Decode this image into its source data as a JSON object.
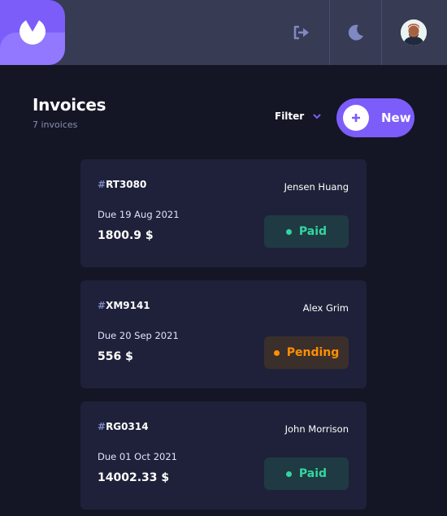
{
  "header": {
    "logo_icon": "logo-icon",
    "icons": [
      "logout-icon",
      "moon-icon"
    ],
    "avatar": "avatar"
  },
  "page": {
    "title": "Invoices",
    "count": "7 invoices"
  },
  "toolbar": {
    "filter_label": "Filter",
    "new_label": "New"
  },
  "colors": {
    "accent": "#7c5dfa",
    "background": "#141625",
    "card": "#1e2139",
    "paid": "#33d69f",
    "pending": "#ff8f00"
  },
  "invoices": [
    {
      "hash": "#",
      "id": "RT3080",
      "client": "Jensen Huang",
      "due": "Due 19 Aug 2021",
      "amount": "1800.9 $",
      "status": "Paid"
    },
    {
      "hash": "#",
      "id": "XM9141",
      "client": "Alex Grim",
      "due": "Due 20 Sep 2021",
      "amount": "556 $",
      "status": "Pending"
    },
    {
      "hash": "#",
      "id": "RG0314",
      "client": "John Morrison",
      "due": "Due 01 Oct 2021",
      "amount": "14002.33 $",
      "status": "Paid"
    }
  ]
}
